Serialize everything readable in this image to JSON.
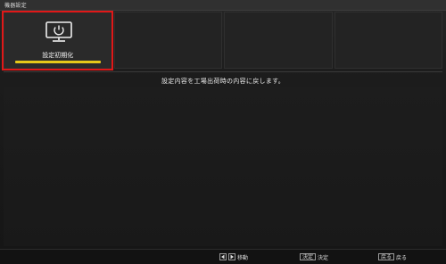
{
  "window": {
    "title": "機器設定"
  },
  "tiles": [
    {
      "label": "設定初期化",
      "icon": "monitor-power-icon",
      "selected": true
    }
  ],
  "content": {
    "description": "設定内容を工場出荷時の内容に戻します。"
  },
  "footer": {
    "move_label": "移動",
    "enter_key": "決定",
    "enter_label": "決定",
    "back_key": "戻る",
    "back_label": "戻る"
  },
  "colors": {
    "highlight": "#e01818",
    "selected_underline": "#e6c81a"
  }
}
